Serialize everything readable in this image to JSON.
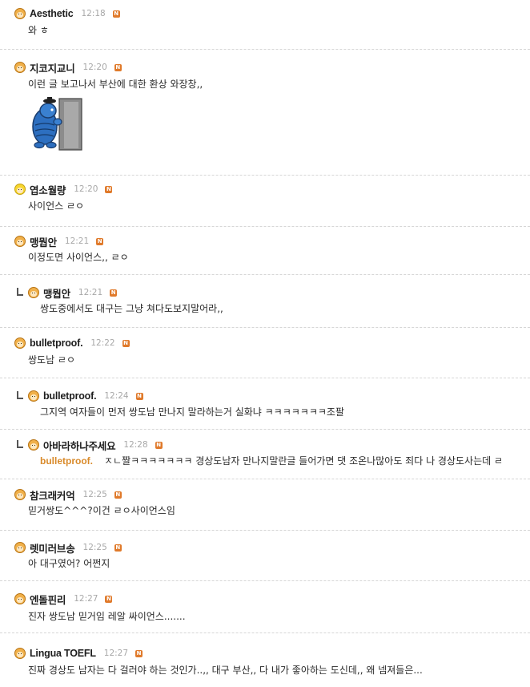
{
  "comments": [
    {
      "nick": "Aesthetic",
      "time": "12:18",
      "text": "와 ㅎ",
      "reply": false,
      "avatar": "orange"
    },
    {
      "nick": "지코지교니",
      "time": "12:20",
      "text": "이런 글 보고나서 부산에 대한 환상 와장창,,",
      "reply": false,
      "avatar": "orange",
      "sticker": "blue-character-peeking-door"
    },
    {
      "nick": "엽소월량",
      "time": "12:20",
      "text": "사이언스 ㄹㅇ",
      "reply": false,
      "avatar": "yellow"
    },
    {
      "nick": "맹뭡안",
      "time": "12:21",
      "text": "이정도면 사이언스,, ㄹㅇ",
      "reply": false,
      "avatar": "orange"
    },
    {
      "nick": "맹뭡안",
      "time": "12:21",
      "text": "쌍도중에서도 대구는 그냥 쳐다도보지말어라,,",
      "reply": true,
      "avatar": "orange"
    },
    {
      "nick": "bulletproof.",
      "time": "12:22",
      "text": "쌍도남 ㄹㅇ",
      "reply": false,
      "avatar": "orange"
    },
    {
      "nick": "bulletproof.",
      "time": "12:24",
      "text": "그지역 여자들이 먼저 쌍도남 만나지 말라하는거 실화냐 ㅋㅋㅋㅋㅋㅋㅋ조팔",
      "reply": true,
      "avatar": "orange"
    },
    {
      "nick": "아바라하나주세요",
      "time": "12:28",
      "mention": "bulletproof.",
      "text": "ㅈㄴ짤ㅋㅋㅋㅋㅋㅋㅋ 경상도남자 만나지말란글 들어가면 댓 조온나많아도 죄다 나 경상도사는데 ㄹ",
      "reply": true,
      "avatar": "orange"
    },
    {
      "nick": "참크래커억",
      "time": "12:25",
      "text": "믿거쌍도^^^?이건 ㄹㅇ사이언스임",
      "reply": false,
      "avatar": "orange"
    },
    {
      "nick": "렛미러브송",
      "time": "12:25",
      "text": "아 대구였어? 어쩐지",
      "reply": false,
      "avatar": "orange"
    },
    {
      "nick": "엔돌핀리",
      "time": "12:27",
      "text": "진자 쌍도남 믿거임 레알 싸이언스.......",
      "reply": false,
      "avatar": "orange"
    },
    {
      "nick": "Lingua TOEFL",
      "time": "12:27",
      "text": "진짜 경상도 남자는 다 걸러야 하는 것인가..,, 대구 부산,, 다 내가 좋아하는 도신데,, 왜 넴져들은...",
      "reply": false,
      "avatar": "orange"
    }
  ],
  "badge_label": "N",
  "colors": {
    "badge": "#e07a2b",
    "mention": "#d98a2a",
    "time": "#a8a8a8",
    "divider": "#d6d6d6"
  }
}
